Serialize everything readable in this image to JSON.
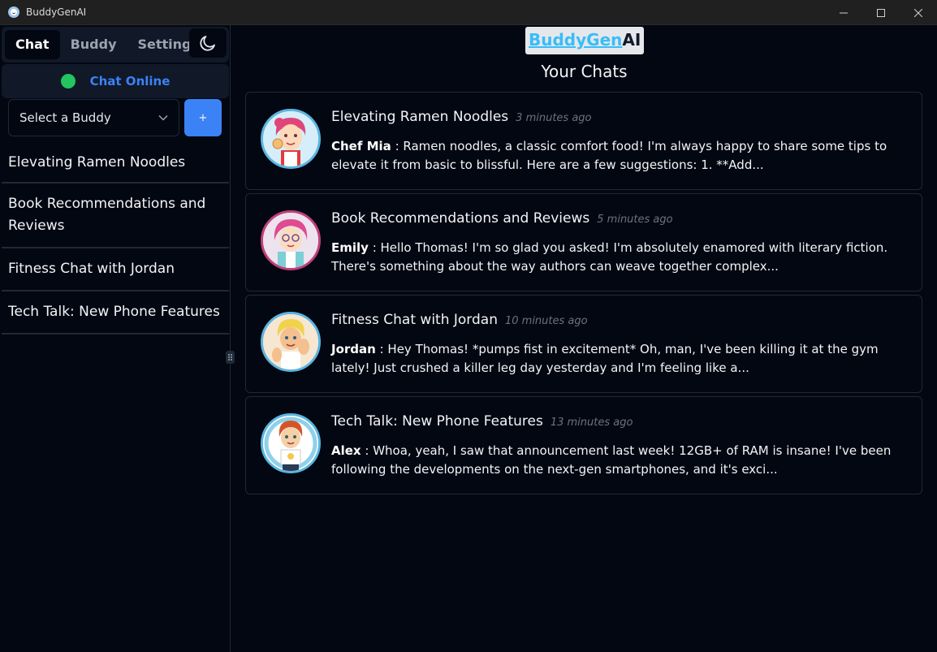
{
  "window": {
    "title": "BuddyGenAI"
  },
  "nav": {
    "tabs": [
      "Chat",
      "Buddy",
      "Settings"
    ]
  },
  "status": {
    "text": "Chat Online"
  },
  "buddy_select": {
    "value": "Select a Buddy",
    "add_label": "+"
  },
  "sidebar_chats": [
    "Elevating Ramen Noodles",
    "Book Recommendations and Reviews",
    "Fitness Chat with Jordan",
    "Tech Talk: New Phone Features"
  ],
  "brand": {
    "part1": "BuddyGen",
    "part2": "AI"
  },
  "main": {
    "title": "Your Chats"
  },
  "chats": [
    {
      "title": "Elevating Ramen Noodles",
      "time": "3 minutes ago",
      "sender": "Chef Mia",
      "message": " : Ramen noodles, a classic comfort food! I'm always happy to share some tips to elevate it from basic to blissful. Here are a few suggestions: 1. **Add..."
    },
    {
      "title": "Book Recommendations and Reviews",
      "time": "5 minutes ago",
      "sender": "Emily",
      "message": " : Hello Thomas! I'm so glad you asked! I'm absolutely enamored with literary fiction. There's something about the way authors can weave together complex..."
    },
    {
      "title": "Fitness Chat with Jordan",
      "time": "10 minutes ago",
      "sender": "Jordan",
      "message": " : Hey Thomas! *pumps fist in excitement* Oh, man, I've been killing it at the gym lately! Just crushed a killer leg day yesterday and I'm feeling like a..."
    },
    {
      "title": "Tech Talk: New Phone Features",
      "time": "13 minutes ago",
      "sender": "Alex",
      "message": " : Whoa, yeah, I saw that announcement last week! 12GB+ of RAM is insane! I've been following the developments on the next-gen smartphones, and it's exci..."
    }
  ],
  "colors": {
    "accent": "#3b82f6",
    "online": "#22c55e",
    "background": "#030712",
    "brand_link": "#38bdf8"
  }
}
